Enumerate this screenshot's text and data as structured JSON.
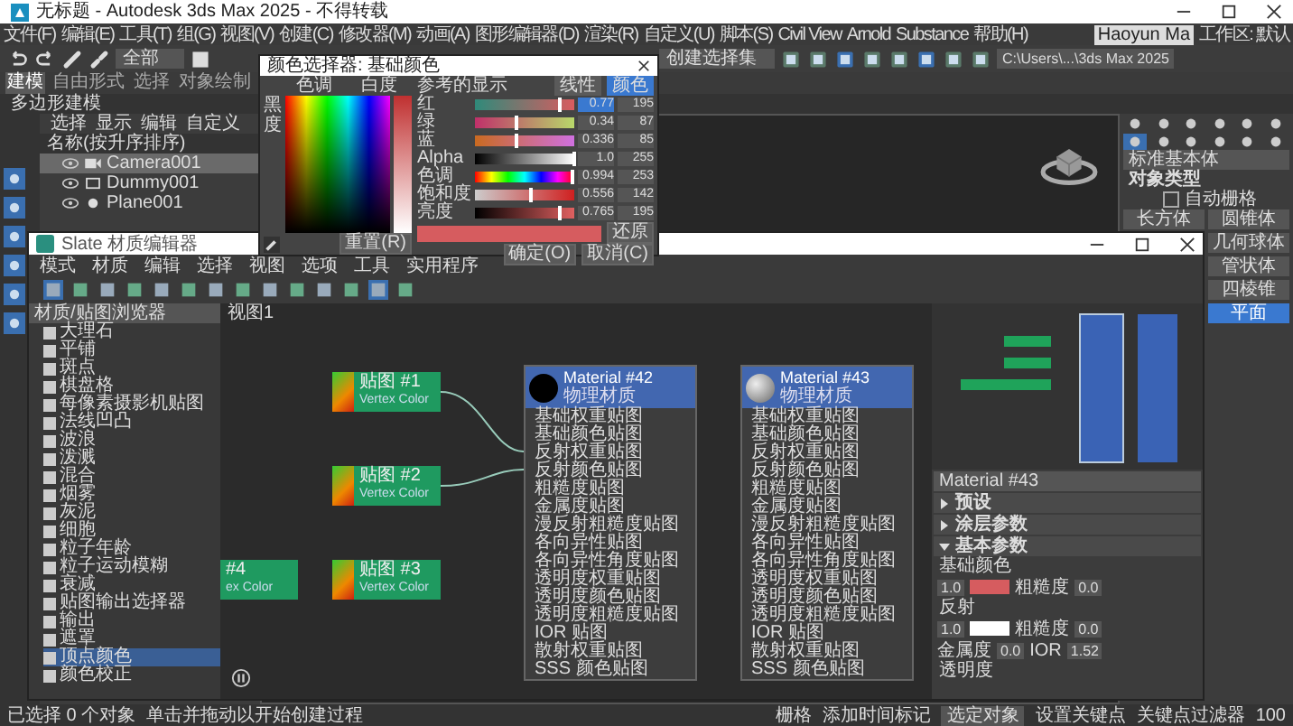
{
  "window": {
    "title": "无标题 - Autodesk 3ds Max 2025 - 不得转载"
  },
  "menu": [
    "文件(F)",
    "编辑(E)",
    "工具(T)",
    "组(G)",
    "视图(V)",
    "创建(C)",
    "修改器(M)",
    "动画(A)",
    "图形编辑器(D)",
    "渲染(R)",
    "自定义(U)",
    "脚本(S)",
    "Civil View",
    "Arnold",
    "Substance",
    "帮助(H)"
  ],
  "user": "Haoyun Ma",
  "workspace": "工作区: 默认",
  "selection_set": "创建选择集",
  "project_path": "C:\\Users\\...\\3ds Max 2025",
  "view_filter": "全部",
  "ribbon_tabs": [
    {
      "label": "建模",
      "selected": true
    },
    {
      "label": "自由形式",
      "selected": false
    },
    {
      "label": "选择",
      "selected": false
    },
    {
      "label": "对象绘制",
      "selected": false
    }
  ],
  "ribbon_label": "多边形建模",
  "scene_explorer": {
    "tabs": [
      "选择",
      "显示",
      "编辑",
      "自定义"
    ],
    "header": "名称(按升序排序)",
    "items": [
      {
        "name": "Camera001",
        "kind": "camera",
        "selected": true
      },
      {
        "name": "Dummy001",
        "kind": "dummy",
        "selected": false
      },
      {
        "name": "Plane001",
        "kind": "plane",
        "selected": false
      }
    ]
  },
  "command_panel": {
    "dropdown": "标准基本体",
    "section": "对象类型",
    "autogrid": {
      "label": "自动栅格",
      "checked": false
    },
    "buttons": [
      {
        "label": "长方体",
        "selected": false
      },
      {
        "label": "圆锥体",
        "selected": false
      },
      {
        "label": "几何球体",
        "selected": false
      },
      {
        "label": "管状体",
        "selected": false
      },
      {
        "label": "四棱锥",
        "selected": false
      },
      {
        "label": "平面",
        "selected": true
      }
    ]
  },
  "color_picker": {
    "title": "颜色选择器: 基础颜色",
    "hue_label": "色调",
    "whiteness_label": "白度",
    "blackness_label": "黑度",
    "display_label": "参考的显示",
    "mode_buttons": [
      {
        "label": "线性",
        "selected": false
      },
      {
        "label": "颜色",
        "selected": true
      }
    ],
    "channels": [
      {
        "name": "红",
        "kind": "red",
        "level": 0.86,
        "value": "0.77",
        "value2": "195"
      },
      {
        "name": "绿",
        "kind": "green",
        "level": 0.42,
        "value": "0.34",
        "value2": "87"
      },
      {
        "name": "蓝",
        "kind": "blue",
        "level": 0.41,
        "value": "0.336",
        "value2": "85"
      },
      {
        "name": "Alpha",
        "kind": "alpha",
        "level": 1,
        "value": "1.0",
        "value2": "255"
      },
      {
        "name": "色调",
        "kind": "hue",
        "level": 0.98,
        "value": "0.994",
        "value2": "253"
      },
      {
        "name": "饱和度",
        "kind": "saturation",
        "level": 0.56,
        "value": "0.556",
        "value2": "142"
      },
      {
        "name": "亮度",
        "kind": "value",
        "level": 0.86,
        "value": "0.765",
        "value2": "195"
      }
    ],
    "restore": "还原",
    "reset": "重置(R)",
    "ok": "确定(O)",
    "cancel": "取消(C)"
  },
  "slate": {
    "title": "Slate 材质编辑器",
    "menu": [
      "模式",
      "材质",
      "编辑",
      "选择",
      "视图",
      "选项",
      "工具",
      "实用程序"
    ],
    "browser_header": "材质/贴图浏览器",
    "view_tab": "视图1",
    "browser_items": [
      {
        "label": "大理石",
        "selected": false
      },
      {
        "label": "平铺",
        "selected": false
      },
      {
        "label": "斑点",
        "selected": false
      },
      {
        "label": "棋盘格",
        "selected": false
      },
      {
        "label": "每像素摄影机贴图",
        "selected": false
      },
      {
        "label": "法线凹凸",
        "selected": false
      },
      {
        "label": "波浪",
        "selected": false
      },
      {
        "label": "泼溅",
        "selected": false
      },
      {
        "label": "混合",
        "selected": false
      },
      {
        "label": "烟雾",
        "selected": false
      },
      {
        "label": "灰泥",
        "selected": false
      },
      {
        "label": "细胞",
        "selected": false
      },
      {
        "label": "粒子年龄",
        "selected": false
      },
      {
        "label": "粒子运动模糊",
        "selected": false
      },
      {
        "label": "衰减",
        "selected": false
      },
      {
        "label": "贴图输出选择器",
        "selected": false
      },
      {
        "label": "输出",
        "selected": false
      },
      {
        "label": "遮罩",
        "selected": false
      },
      {
        "label": "顶点颜色",
        "selected": true
      },
      {
        "label": "颜色校正",
        "selected": false
      }
    ],
    "map_nodes": [
      {
        "title": "贴图 #1",
        "subtitle": "Vertex Color"
      },
      {
        "title": "贴图 #2",
        "subtitle": "Vertex Color"
      },
      {
        "title": "贴图 #3",
        "subtitle": "Vertex Color"
      }
    ],
    "partial_node": {
      "title": "#4",
      "subtitle": "ex Color"
    },
    "material_nodes": [
      {
        "title": "Material #42",
        "subtitle": "物理材质",
        "kind": "dark",
        "slots": [
          "基础权重贴图",
          "基础颜色贴图",
          "反射权重贴图",
          "反射颜色贴图",
          "粗糙度贴图",
          "金属度贴图",
          "漫反射粗糙度贴图",
          "各向异性贴图",
          "各向异性角度贴图",
          "透明度权重贴图",
          "透明度颜色贴图",
          "透明度粗糙度贴图",
          "IOR 贴图",
          "散射权重贴图",
          "SSS 颜色贴图"
        ]
      },
      {
        "title": "Material #43",
        "subtitle": "物理材质",
        "kind": "sphere",
        "slots": [
          "基础权重贴图",
          "基础颜色贴图",
          "反射权重贴图",
          "反射颜色贴图",
          "粗糙度贴图",
          "金属度贴图",
          "漫反射粗糙度贴图",
          "各向异性贴图",
          "各向异性角度贴图",
          "透明度权重贴图",
          "透明度颜色贴图",
          "透明度粗糙度贴图",
          "IOR 贴图",
          "散射权重贴图",
          "SSS 颜色贴图"
        ]
      }
    ],
    "params": {
      "material": "Material #43",
      "sections": [
        {
          "label": "预设",
          "expanded": false
        },
        {
          "label": "涂层参数",
          "expanded": false
        },
        {
          "label": "基本参数",
          "expanded": true
        }
      ],
      "base_label": "基础颜色",
      "base_value": "1.0",
      "roughness_label": "粗糙度",
      "roughness_value": "0.0",
      "reflect_label": "反射",
      "reflect_value": "1.0",
      "reflect_rough_label": "粗糙度",
      "reflect_rough_value": "0.0",
      "metal_label": "金属度",
      "metal_value": "0.0",
      "ior_label": "IOR",
      "ior_value": "1.52",
      "transparency_label": "透明度"
    }
  },
  "status": {
    "selection": "已选择 0 个对象",
    "prompt": "单击并拖动以开始创建过程",
    "grid": "栅格",
    "time_tag": "添加时间标记",
    "selected_dropdown": "选定对象",
    "set_key": "设置关键点",
    "key_filter": "关键点过滤器",
    "frame": "100"
  }
}
